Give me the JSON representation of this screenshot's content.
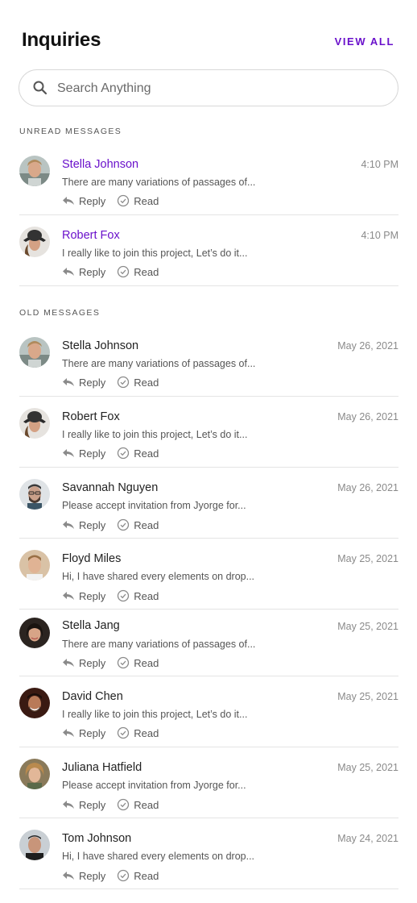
{
  "header": {
    "title": "Inquiries",
    "view_all": "VIEW ALL"
  },
  "search": {
    "placeholder": "Search Anything",
    "value": ""
  },
  "sections": {
    "unread_label": "UNREAD MESSAGES",
    "old_label": "OLD MESSAGES"
  },
  "actions": {
    "reply": "Reply",
    "read": "Read"
  },
  "colors": {
    "accent": "#6a11cb",
    "divider": "#e4e4e4",
    "muted": "#8a8a8a"
  },
  "unread": [
    {
      "name": "Stella Johnson",
      "time": "4:10 PM",
      "preview": "There are many variations of passages of..."
    },
    {
      "name": "Robert Fox",
      "time": "4:10 PM",
      "preview": "I really like to join this project, Let’s do it..."
    }
  ],
  "old": [
    {
      "name": "Stella Johnson",
      "time": "May 26, 2021",
      "preview": "There are many variations of passages of..."
    },
    {
      "name": "Robert Fox",
      "time": "May 26, 2021",
      "preview": "I really like to join this project, Let’s do it..."
    },
    {
      "name": "Savannah Nguyen",
      "time": "May 26, 2021",
      "preview": "Please accept invitation from Jyorge for..."
    },
    {
      "name": "Floyd Miles",
      "time": "May 25, 2021",
      "preview": "Hi, I have shared every elements on drop..."
    },
    {
      "name": "Stella Jang",
      "time": "May 25, 2021",
      "preview": "There are many variations of passages of..."
    },
    {
      "name": "David Chen",
      "time": "May 25, 2021",
      "preview": "I really like to join this project, Let’s do it..."
    },
    {
      "name": "Juliana Hatfield",
      "time": "May 25, 2021",
      "preview": "Please accept invitation from Jyorge for..."
    },
    {
      "name": "Tom Johnson",
      "time": "May 24, 2021",
      "preview": "Hi, I have shared every elements on drop..."
    }
  ]
}
